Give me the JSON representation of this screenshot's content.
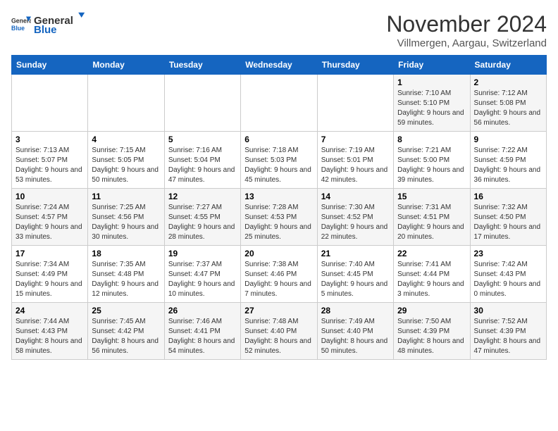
{
  "header": {
    "logo": {
      "general": "General",
      "blue": "Blue"
    },
    "title": "November 2024",
    "subtitle": "Villmergen, Aargau, Switzerland"
  },
  "days_of_week": [
    "Sunday",
    "Monday",
    "Tuesday",
    "Wednesday",
    "Thursday",
    "Friday",
    "Saturday"
  ],
  "weeks": [
    [
      {
        "day": "",
        "info": ""
      },
      {
        "day": "",
        "info": ""
      },
      {
        "day": "",
        "info": ""
      },
      {
        "day": "",
        "info": ""
      },
      {
        "day": "",
        "info": ""
      },
      {
        "day": "1",
        "info": "Sunrise: 7:10 AM\nSunset: 5:10 PM\nDaylight: 9 hours and 59 minutes."
      },
      {
        "day": "2",
        "info": "Sunrise: 7:12 AM\nSunset: 5:08 PM\nDaylight: 9 hours and 56 minutes."
      }
    ],
    [
      {
        "day": "3",
        "info": "Sunrise: 7:13 AM\nSunset: 5:07 PM\nDaylight: 9 hours and 53 minutes."
      },
      {
        "day": "4",
        "info": "Sunrise: 7:15 AM\nSunset: 5:05 PM\nDaylight: 9 hours and 50 minutes."
      },
      {
        "day": "5",
        "info": "Sunrise: 7:16 AM\nSunset: 5:04 PM\nDaylight: 9 hours and 47 minutes."
      },
      {
        "day": "6",
        "info": "Sunrise: 7:18 AM\nSunset: 5:03 PM\nDaylight: 9 hours and 45 minutes."
      },
      {
        "day": "7",
        "info": "Sunrise: 7:19 AM\nSunset: 5:01 PM\nDaylight: 9 hours and 42 minutes."
      },
      {
        "day": "8",
        "info": "Sunrise: 7:21 AM\nSunset: 5:00 PM\nDaylight: 9 hours and 39 minutes."
      },
      {
        "day": "9",
        "info": "Sunrise: 7:22 AM\nSunset: 4:59 PM\nDaylight: 9 hours and 36 minutes."
      }
    ],
    [
      {
        "day": "10",
        "info": "Sunrise: 7:24 AM\nSunset: 4:57 PM\nDaylight: 9 hours and 33 minutes."
      },
      {
        "day": "11",
        "info": "Sunrise: 7:25 AM\nSunset: 4:56 PM\nDaylight: 9 hours and 30 minutes."
      },
      {
        "day": "12",
        "info": "Sunrise: 7:27 AM\nSunset: 4:55 PM\nDaylight: 9 hours and 28 minutes."
      },
      {
        "day": "13",
        "info": "Sunrise: 7:28 AM\nSunset: 4:53 PM\nDaylight: 9 hours and 25 minutes."
      },
      {
        "day": "14",
        "info": "Sunrise: 7:30 AM\nSunset: 4:52 PM\nDaylight: 9 hours and 22 minutes."
      },
      {
        "day": "15",
        "info": "Sunrise: 7:31 AM\nSunset: 4:51 PM\nDaylight: 9 hours and 20 minutes."
      },
      {
        "day": "16",
        "info": "Sunrise: 7:32 AM\nSunset: 4:50 PM\nDaylight: 9 hours and 17 minutes."
      }
    ],
    [
      {
        "day": "17",
        "info": "Sunrise: 7:34 AM\nSunset: 4:49 PM\nDaylight: 9 hours and 15 minutes."
      },
      {
        "day": "18",
        "info": "Sunrise: 7:35 AM\nSunset: 4:48 PM\nDaylight: 9 hours and 12 minutes."
      },
      {
        "day": "19",
        "info": "Sunrise: 7:37 AM\nSunset: 4:47 PM\nDaylight: 9 hours and 10 minutes."
      },
      {
        "day": "20",
        "info": "Sunrise: 7:38 AM\nSunset: 4:46 PM\nDaylight: 9 hours and 7 minutes."
      },
      {
        "day": "21",
        "info": "Sunrise: 7:40 AM\nSunset: 4:45 PM\nDaylight: 9 hours and 5 minutes."
      },
      {
        "day": "22",
        "info": "Sunrise: 7:41 AM\nSunset: 4:44 PM\nDaylight: 9 hours and 3 minutes."
      },
      {
        "day": "23",
        "info": "Sunrise: 7:42 AM\nSunset: 4:43 PM\nDaylight: 9 hours and 0 minutes."
      }
    ],
    [
      {
        "day": "24",
        "info": "Sunrise: 7:44 AM\nSunset: 4:43 PM\nDaylight: 8 hours and 58 minutes."
      },
      {
        "day": "25",
        "info": "Sunrise: 7:45 AM\nSunset: 4:42 PM\nDaylight: 8 hours and 56 minutes."
      },
      {
        "day": "26",
        "info": "Sunrise: 7:46 AM\nSunset: 4:41 PM\nDaylight: 8 hours and 54 minutes."
      },
      {
        "day": "27",
        "info": "Sunrise: 7:48 AM\nSunset: 4:40 PM\nDaylight: 8 hours and 52 minutes."
      },
      {
        "day": "28",
        "info": "Sunrise: 7:49 AM\nSunset: 4:40 PM\nDaylight: 8 hours and 50 minutes."
      },
      {
        "day": "29",
        "info": "Sunrise: 7:50 AM\nSunset: 4:39 PM\nDaylight: 8 hours and 48 minutes."
      },
      {
        "day": "30",
        "info": "Sunrise: 7:52 AM\nSunset: 4:39 PM\nDaylight: 8 hours and 47 minutes."
      }
    ]
  ]
}
